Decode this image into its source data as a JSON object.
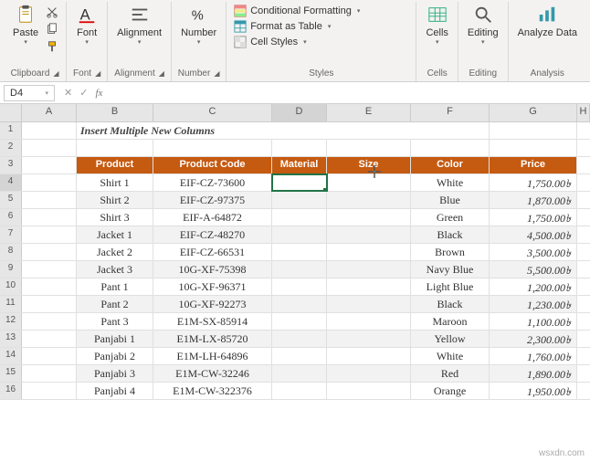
{
  "ribbon": {
    "clipboard": {
      "label": "Clipboard",
      "paste": "Paste"
    },
    "font": {
      "label": "Font",
      "btn": "Font"
    },
    "alignment": {
      "label": "Alignment",
      "btn": "Alignment"
    },
    "number": {
      "label": "Number",
      "btn": "Number"
    },
    "styles": {
      "label": "Styles",
      "conditional": "Conditional Formatting",
      "table": "Format as Table",
      "cell": "Cell Styles"
    },
    "cells": {
      "label": "Cells",
      "btn": "Cells"
    },
    "editing": {
      "label": "Editing",
      "btn": "Editing"
    },
    "analysis": {
      "label": "Analysis",
      "btn": "Analyze Data"
    }
  },
  "namebox": "D4",
  "columns": [
    "A",
    "B",
    "C",
    "D",
    "E",
    "F",
    "G",
    "H"
  ],
  "sheet_title": "Insert Multiple New Columns",
  "headers": {
    "product": "Product",
    "code": "Product Code",
    "material": "Material",
    "size": "Size",
    "color": "Color",
    "price": "Price"
  },
  "rows": [
    {
      "product": "Shirt 1",
      "code": "EIF-CZ-73600",
      "color": "White",
      "price": "1,750.00৳"
    },
    {
      "product": "Shirt 2",
      "code": "EIF-CZ-97375",
      "color": "Blue",
      "price": "1,870.00৳"
    },
    {
      "product": "Shirt 3",
      "code": "EIF-A-64872",
      "color": "Green",
      "price": "1,750.00৳"
    },
    {
      "product": "Jacket 1",
      "code": "EIF-CZ-48270",
      "color": "Black",
      "price": "4,500.00৳"
    },
    {
      "product": "Jacket 2",
      "code": "EIF-CZ-66531",
      "color": "Brown",
      "price": "3,500.00৳"
    },
    {
      "product": "Jacket 3",
      "code": "10G-XF-75398",
      "color": "Navy Blue",
      "price": "5,500.00৳"
    },
    {
      "product": "Pant 1",
      "code": "10G-XF-96371",
      "color": "Light Blue",
      "price": "1,200.00৳"
    },
    {
      "product": "Pant 2",
      "code": "10G-XF-92273",
      "color": "Black",
      "price": "1,230.00৳"
    },
    {
      "product": "Pant 3",
      "code": "E1M-SX-85914",
      "color": "Maroon",
      "price": "1,100.00৳"
    },
    {
      "product": "Panjabi 1",
      "code": "E1M-LX-85720",
      "color": "Yellow",
      "price": "2,300.00৳"
    },
    {
      "product": "Panjabi 2",
      "code": "E1M-LH-64896",
      "color": "White",
      "price": "1,760.00৳"
    },
    {
      "product": "Panjabi 3",
      "code": "E1M-CW-32246",
      "color": "Red",
      "price": "1,890.00৳"
    },
    {
      "product": "Panjabi 4",
      "code": "E1M-CW-322376",
      "color": "Orange",
      "price": "1,950.00৳"
    }
  ],
  "watermark": "wsxdn.com"
}
